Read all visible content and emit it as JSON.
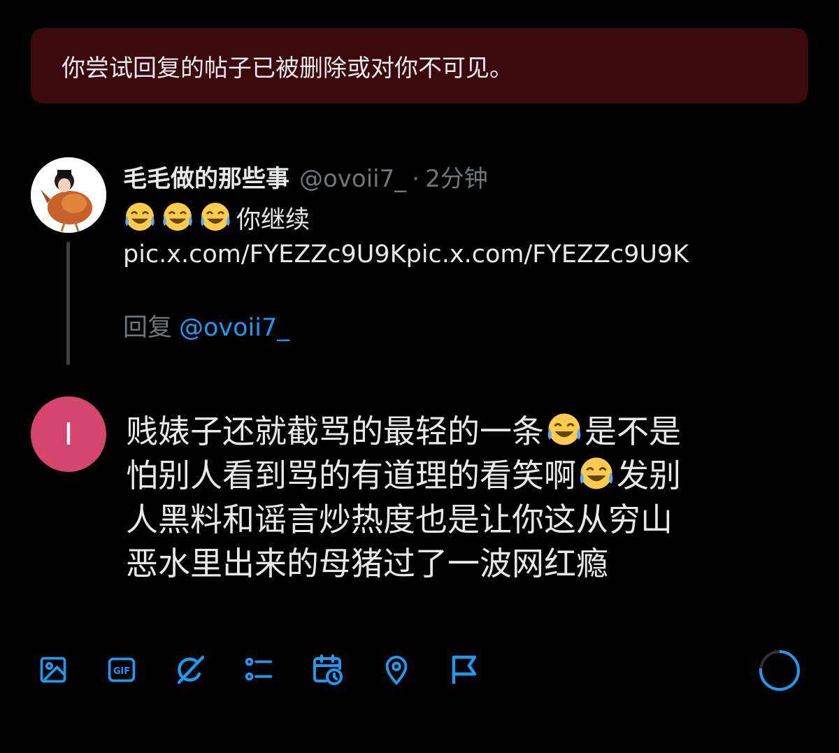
{
  "banner": {
    "text": "你尝试回复的帖子已被删除或对你不可见。"
  },
  "parent_post": {
    "author_name": "毛毛做的那些事",
    "handle": "@ovoii7_",
    "separator": "·",
    "time": "2分钟",
    "emoji": "face-with-tears-of-joy",
    "text_after_emoji": "你继续",
    "link_text": "pic.x.com/FYEZZc9U9Kpic.x.com/FYEZZc9U9K",
    "reply_label": "回复",
    "reply_handle": "@ovoii7_"
  },
  "compose": {
    "avatar_letter": "I",
    "avatar_color": "#d6456e",
    "line1_a": "贱婊子还就截骂的最轻的一条",
    "line1_b": "是不是",
    "line2_a": "怕别人看到骂的有道理的看笑啊",
    "line2_b": "发别",
    "line3": "人黑料和谣言炒热度也是让你这从穷山",
    "line4": "恶水里出来的母猪过了一波网红瘾"
  },
  "toolbar": {
    "accent_color": "#1d9bf0",
    "icons": [
      "image-icon",
      "gif-icon",
      "grok-icon",
      "poll-icon",
      "schedule-icon",
      "location-icon",
      "flag-icon"
    ],
    "gif_label": "GIF"
  },
  "colors": {
    "background": "#000000",
    "banner": "#3a0a0c",
    "muted": "#71767b"
  }
}
